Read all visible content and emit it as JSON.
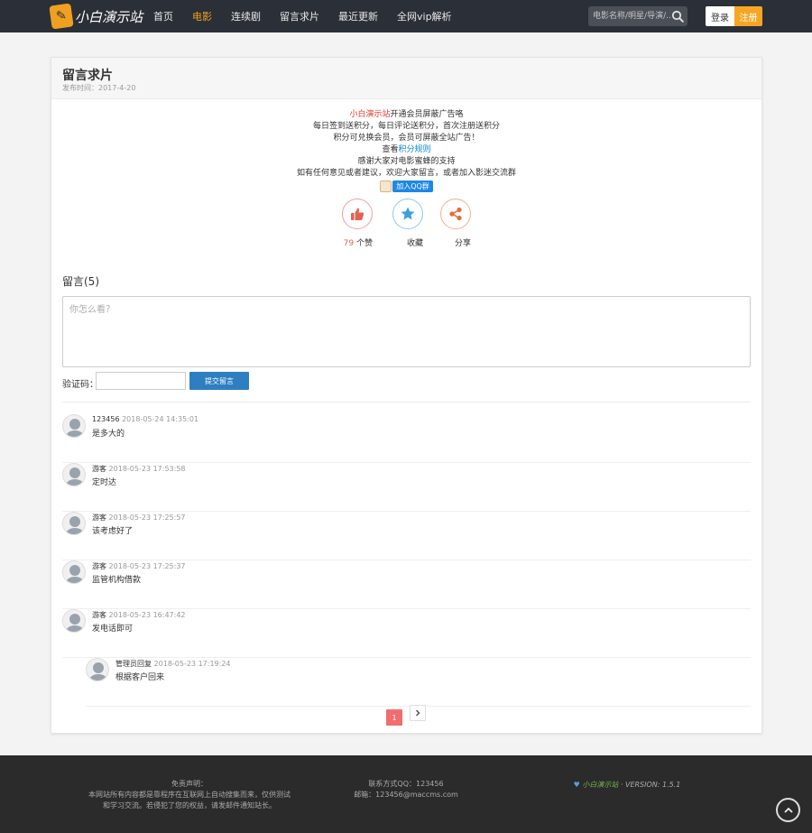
{
  "header": {
    "logo_text": "小白演示站",
    "nav": [
      "首页",
      "电影",
      "连续剧",
      "留言求片",
      "最近更新",
      "全网vip解析"
    ],
    "active_nav": "电影",
    "search_placeholder": "电影名称/明星/导演/...",
    "login": "登录",
    "register": "注册",
    "colors": {
      "bar": "#2b2f37",
      "accent": "#f5a623"
    }
  },
  "page": {
    "title": "留言求片",
    "publish_label": "发布时间：",
    "publish_date": "2017-4-20"
  },
  "notice": {
    "line1_site": "小白演示站",
    "line1_rest": "开通会员屏蔽广告咯",
    "line2": "每日签到送积分，每日评论送积分，首次注册送积分",
    "line3": "积分可兑换会员，会员可屏蔽全站广告！",
    "line4_prefix": "查看",
    "line4_link": "积分规则",
    "line5": "感谢大家对电影蜜蜂的支持",
    "line6": "如有任何意见或者建议，欢迎大家留言，或者加入影迷交流群",
    "qq_button": "加入QQ群"
  },
  "actions": {
    "like_count": "79",
    "like_label": "个赞",
    "favorite_label": "收藏",
    "share_label": "分享",
    "icons": [
      "thumbs-up-icon",
      "star-icon",
      "share-icon"
    ]
  },
  "comments": {
    "title": "留言(5)",
    "placeholder": "你怎么看？",
    "captcha_label": "验证码：",
    "submit": "提交留言",
    "items": [
      {
        "name": "123456",
        "time": "2018-05-24 14:35:01",
        "text": "是多大的"
      },
      {
        "name": "游客",
        "time": "2018-05-23 17:53:58",
        "text": "定时达"
      },
      {
        "name": "游客",
        "time": "2018-05-23 17:25:57",
        "text": "该考虑好了"
      },
      {
        "name": "游客",
        "time": "2018-05-23 17:25:37",
        "text": "监管机构借款"
      },
      {
        "name": "游客",
        "time": "2018-05-23 16:47:42",
        "text": "发电话即可"
      }
    ],
    "reply": {
      "name": "管理员回复",
      "time": "2018-05-23 17:19:24",
      "text": "根据客户回来"
    }
  },
  "pagination": {
    "current": "1",
    "next_icon": "chevron-right-icon"
  },
  "footer": {
    "disclaimer_title": "免责声明：",
    "disclaimer_line1": "本网站所有内容都是靠程序在互联网上自动搜集而来，仅供测试",
    "disclaimer_line2": "和学习交流。若侵犯了您的权益，请发邮件通知站长。",
    "contact_qq": "联系方式QQ：123456",
    "contact_email": "邮箱：123456@maccms.com",
    "heart": "♥",
    "brand": "小白演示站",
    "version": " · VERSION: 1.5.1"
  }
}
